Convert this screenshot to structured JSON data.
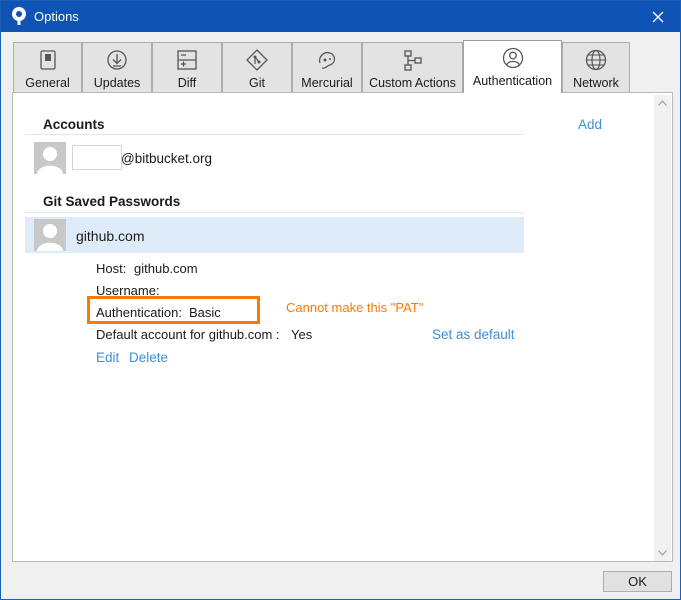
{
  "window": {
    "title": "Options",
    "icon": "sourcetree-logo-icon",
    "close_icon": "close-icon"
  },
  "tabs": [
    {
      "label": "General",
      "icon": "toggle-switch-icon",
      "active": false
    },
    {
      "label": "Updates",
      "icon": "download-circle-icon",
      "active": false
    },
    {
      "label": "Diff",
      "icon": "diff-icon",
      "active": false
    },
    {
      "label": "Git",
      "icon": "git-diamond-icon",
      "active": false
    },
    {
      "label": "Mercurial",
      "icon": "mercurial-icon",
      "active": false
    },
    {
      "label": "Custom Actions",
      "icon": "custom-actions-icon",
      "active": false
    },
    {
      "label": "Authentication",
      "icon": "user-circle-icon",
      "active": true
    },
    {
      "label": "Network",
      "icon": "globe-icon",
      "active": false
    }
  ],
  "accounts": {
    "title": "Accounts",
    "add_label": "Add",
    "items": [
      {
        "username_suffix": "@bitbucket.org"
      }
    ]
  },
  "git_saved_passwords": {
    "title": "Git Saved Passwords",
    "selected_host": "github.com",
    "details": {
      "host_label": "Host:",
      "host_value": "github.com",
      "username_label": "Username:",
      "username_value": "",
      "auth_label": "Authentication:",
      "auth_value": "Basic",
      "default_label": "Default account for github.com :",
      "default_value": "Yes",
      "set_default_label": "Set as default",
      "edit_label": "Edit",
      "delete_label": "Delete"
    }
  },
  "annotation": {
    "text": "Cannot make this \"PAT\"",
    "color": "#f57c00"
  },
  "footer": {
    "ok_label": "OK"
  },
  "colors": {
    "titlebar": "#0f54b4",
    "link": "#3d8fd8",
    "selection": "#ddecf8"
  }
}
